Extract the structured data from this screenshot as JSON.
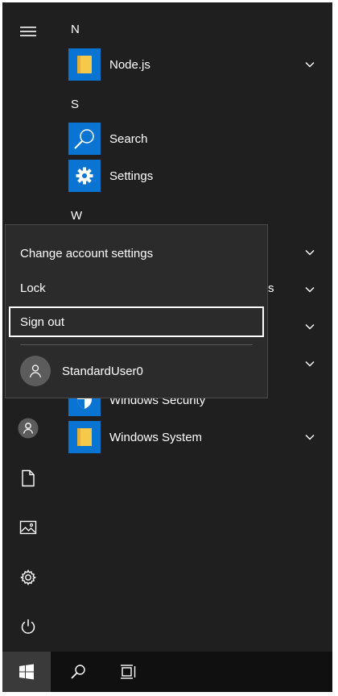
{
  "start_menu": {
    "groups": [
      {
        "letter": "N",
        "apps": [
          {
            "label": "Node.js",
            "icon": "folder-icon",
            "expandable": true
          }
        ]
      },
      {
        "letter": "S",
        "apps": [
          {
            "label": "Search",
            "icon": "search-icon",
            "expandable": false
          },
          {
            "label": "Settings",
            "icon": "gear-icon",
            "expandable": false
          }
        ]
      },
      {
        "letter": "W",
        "apps": [
          {
            "label": "Windows Security",
            "icon": "shield-icon",
            "expandable": false
          },
          {
            "label": "Windows System",
            "icon": "folder-icon",
            "expandable": true
          }
        ]
      }
    ],
    "partial_text_behind_popup": "s"
  },
  "account_popup": {
    "items": [
      {
        "label": "Change account settings",
        "focused": false
      },
      {
        "label": "Lock",
        "focused": false
      },
      {
        "label": "Sign out",
        "focused": true
      }
    ],
    "user": {
      "name": "StandardUser0",
      "icon": "user-icon"
    }
  },
  "rail": {
    "buttons": [
      "hamburger-menu-icon",
      "user-icon",
      "document-icon",
      "pictures-icon",
      "gear-icon",
      "power-icon"
    ]
  },
  "taskbar": {
    "buttons": [
      "windows-start-icon",
      "search-icon",
      "task-view-icon"
    ]
  },
  "colors": {
    "background": "#1f1f1f",
    "tile_blue": "#0a74d3",
    "tile_folder_yellow": "#f6c94a",
    "popup": "#2b2b2b",
    "taskbar": "#101010"
  }
}
